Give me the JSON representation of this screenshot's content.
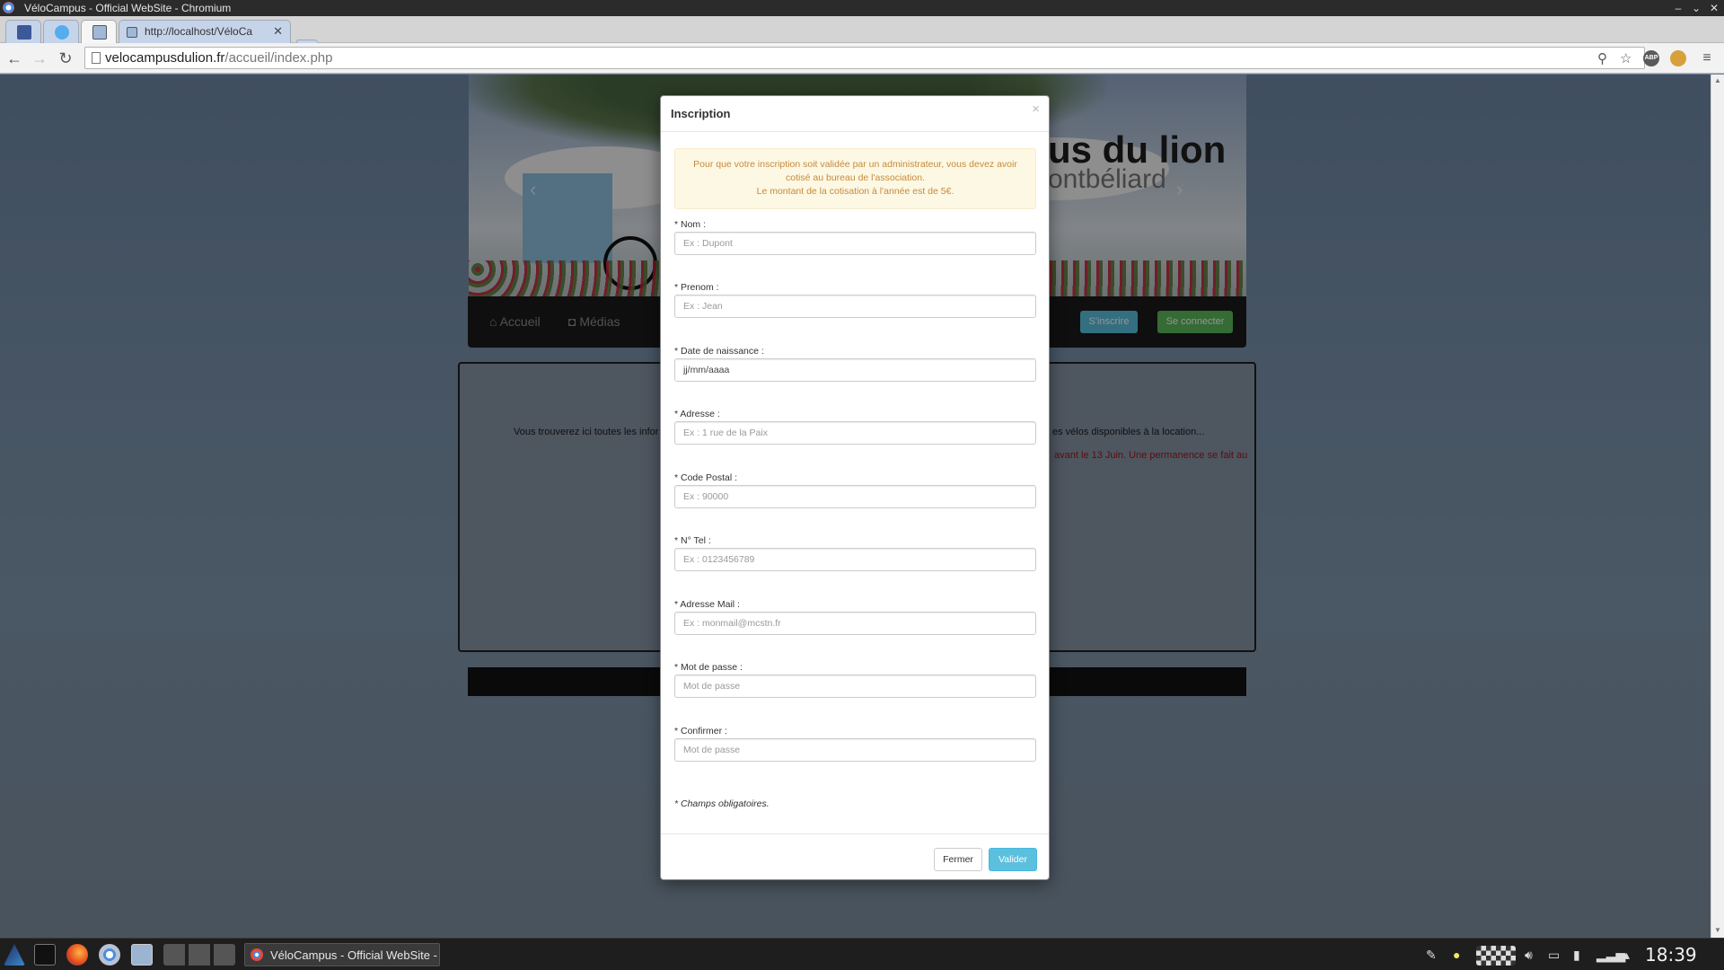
{
  "window": {
    "title": "VéloCampus - Official WebSite - Chromium"
  },
  "tabs": [
    {
      "label": "",
      "favicon": "facebook-icon"
    },
    {
      "label": "",
      "favicon": "twitter-icon"
    },
    {
      "label": "",
      "favicon": "velocampus-icon"
    },
    {
      "label": "http://localhost/VéloCa",
      "favicon": "velocampus-icon",
      "active": true
    }
  ],
  "toolbar": {
    "url_host": "velocampusdulion.fr",
    "url_path": "/accueil/index.php"
  },
  "page": {
    "banner_title": "us du lion",
    "banner_subtitle": "ontbéliard",
    "nav": {
      "home": "Accueil",
      "media": "Médias",
      "register_btn": "S'inscrire",
      "login_btn": "Se connecter"
    },
    "info_left": "Vous trouverez ici toutes les infor",
    "info_right": "es vélos disponibles à la location...",
    "warning_right": "avant le 13 Juin. Une permanence se fait au"
  },
  "modal": {
    "title": "Inscription",
    "close": "×",
    "alert": [
      "Pour que votre inscription soit validée par un administrateur, vous devez avoir",
      "cotisé au bureau de l'association.",
      "Le montant de la cotisation à l'année est de 5€."
    ],
    "fields": [
      {
        "label": "* Nom :",
        "placeholder": "Ex : Dupont",
        "name": "nom-field"
      },
      {
        "label": "* Prenom :",
        "placeholder": "Ex : Jean",
        "name": "prenom-field"
      },
      {
        "label": "* Date de naissance :",
        "placeholder": "jj/mm/aaaa",
        "name": "date-naissance-field"
      },
      {
        "label": "* Adresse :",
        "placeholder": "Ex : 1 rue de la Paix",
        "name": "adresse-field"
      },
      {
        "label": "* Code Postal :",
        "placeholder": "Ex : 90000",
        "name": "code-postal-field"
      },
      {
        "label": "* N° Tel :",
        "placeholder": "Ex : 0123456789",
        "name": "telephone-field"
      },
      {
        "label": "* Adresse Mail :",
        "placeholder": "Ex : monmail@mcstn.fr",
        "name": "email-field"
      },
      {
        "label": "* Mot de passe :",
        "placeholder": "Mot de passe",
        "name": "password-field"
      },
      {
        "label": "* Confirmer :",
        "placeholder": "Mot de passe",
        "name": "password-confirm-field"
      }
    ],
    "required_note": "* Champs obligatoires.",
    "btn_close": "Fermer",
    "btn_submit": "Valider"
  },
  "taskbar": {
    "task_label": "VéloCampus - Official WebSite - Chromium",
    "clock": "18:39"
  },
  "colors": {
    "primary_button": "#5bc0de",
    "success_button": "#5cb85c",
    "alert_bg": "#fcf8e3",
    "alert_text": "#c78a3d",
    "warning_text": "#a31818"
  }
}
